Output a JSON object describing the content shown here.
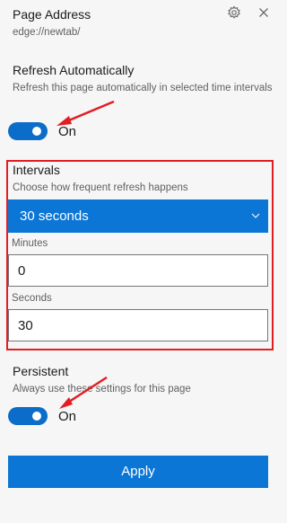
{
  "header": {
    "title": "Page Address",
    "url": "edge://newtab/",
    "settings_icon": "gear-icon",
    "close_icon": "close-icon"
  },
  "refresh": {
    "title": "Refresh Automatically",
    "description": "Refresh this page automatically in selected time intervals",
    "toggle_state": "On",
    "enabled": true
  },
  "intervals": {
    "title": "Intervals",
    "description": "Choose how frequent refresh happens",
    "selected": "30 seconds",
    "minutes_label": "Minutes",
    "minutes_value": "0",
    "seconds_label": "Seconds",
    "seconds_value": "30"
  },
  "persistent": {
    "title": "Persistent",
    "description": "Always use these settings for this page",
    "toggle_state": "On",
    "enabled": true
  },
  "apply_label": "Apply",
  "colors": {
    "accent": "#0b76d6",
    "toggle": "#0c6cc9",
    "annotation": "#e21d23",
    "background": "#f6f6f6"
  }
}
